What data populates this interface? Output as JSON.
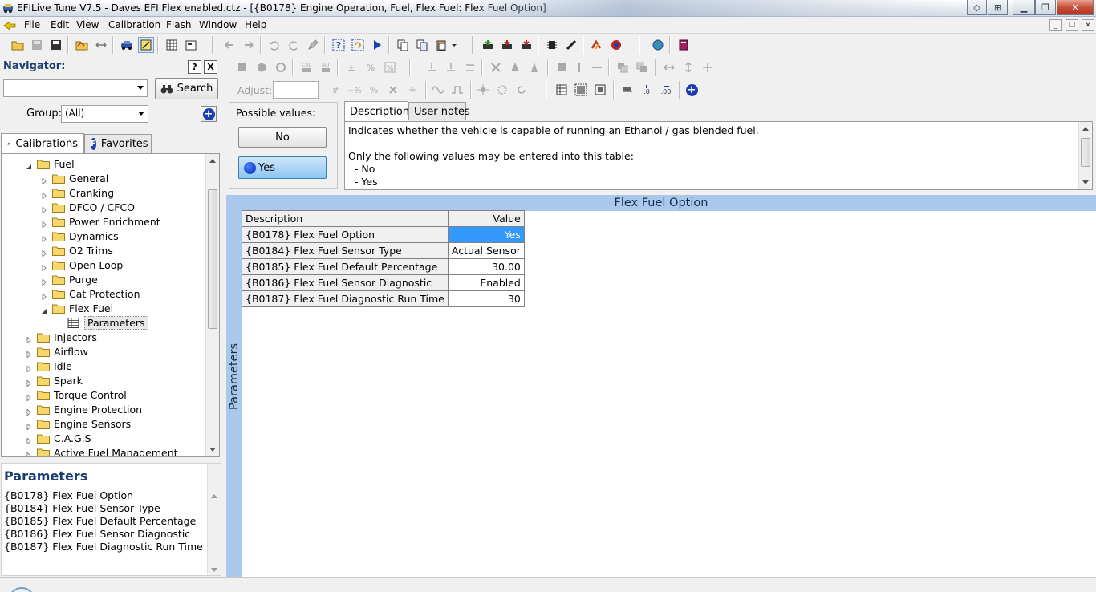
{
  "window": {
    "title": "EFILive Tune V7.5 - Daves EFI Flex enabled.ctz - [{B0178} Engine Operation, Fuel, Flex Fuel: Flex Fuel Option]"
  },
  "menu": {
    "file": "File",
    "edit": "Edit",
    "view": "View",
    "calibration": "Calibration",
    "flash": "Flash",
    "window": "Window",
    "help": "Help"
  },
  "toolbar": {
    "adjust_label": "Adjust:",
    "adjust_value": ""
  },
  "navigator": {
    "label": "Navigator:",
    "help_btn": "?",
    "close_btn": "X",
    "search_value": "",
    "search_button": "Search",
    "group_label": "Group:",
    "group_value": "(All)",
    "tabs": {
      "calibrations": "Calibrations",
      "favorites": "Favorites"
    },
    "tree": [
      {
        "label": "Fuel",
        "level": 1,
        "state": "expanded"
      },
      {
        "label": "General",
        "level": 2,
        "state": "collapsed"
      },
      {
        "label": "Cranking",
        "level": 2,
        "state": "collapsed"
      },
      {
        "label": "DFCO / CFCO",
        "level": 2,
        "state": "collapsed"
      },
      {
        "label": "Power Enrichment",
        "level": 2,
        "state": "collapsed"
      },
      {
        "label": "Dynamics",
        "level": 2,
        "state": "collapsed"
      },
      {
        "label": "O2 Trims",
        "level": 2,
        "state": "collapsed"
      },
      {
        "label": "Open Loop",
        "level": 2,
        "state": "collapsed"
      },
      {
        "label": "Purge",
        "level": 2,
        "state": "collapsed"
      },
      {
        "label": "Cat Protection",
        "level": 2,
        "state": "collapsed"
      },
      {
        "label": "Flex Fuel",
        "level": 2,
        "state": "expanded"
      },
      {
        "label": "Parameters",
        "level": 3,
        "state": "leaf"
      },
      {
        "label": "Injectors",
        "level": 1,
        "state": "collapsed"
      },
      {
        "label": "Airflow",
        "level": 1,
        "state": "collapsed"
      },
      {
        "label": "Idle",
        "level": 1,
        "state": "collapsed"
      },
      {
        "label": "Spark",
        "level": 1,
        "state": "collapsed"
      },
      {
        "label": "Torque Control",
        "level": 1,
        "state": "collapsed"
      },
      {
        "label": "Engine Protection",
        "level": 1,
        "state": "collapsed"
      },
      {
        "label": "Engine Sensors",
        "level": 1,
        "state": "collapsed"
      },
      {
        "label": "C.A.G.S",
        "level": 1,
        "state": "collapsed"
      },
      {
        "label": "Active Fuel Management",
        "level": 1,
        "state": "collapsed"
      }
    ]
  },
  "parameters_panel": {
    "heading": "Parameters",
    "items": [
      "{B0178} Flex Fuel Option",
      "{B0184} Flex Fuel Sensor Type",
      "{B0185} Flex Fuel Default Percentage",
      "{B0186} Flex Fuel Sensor Diagnostic",
      "{B0187} Flex Fuel Diagnostic Run Time"
    ]
  },
  "possible_values": {
    "label": "Possible values:",
    "no": "No",
    "yes": "Yes"
  },
  "description": {
    "tabs": {
      "description": "Description",
      "user_notes": "User notes"
    },
    "lines": [
      "Indicates whether the vehicle is capable of running an Ethanol / gas blended fuel.",
      "",
      "Only the following values may be entered into this table:",
      "  - No",
      "  - Yes"
    ]
  },
  "table": {
    "title": "Flex Fuel Option",
    "side_label": "Parameters",
    "header": {
      "description": "Description",
      "value": "Value"
    },
    "rows": [
      {
        "description": "{B0178} Flex Fuel Option",
        "value": "Yes"
      },
      {
        "description": "{B0184} Flex Fuel Sensor Type",
        "value": "Actual Sensor"
      },
      {
        "description": "{B0185} Flex Fuel Default Percentage",
        "value": "30.00"
      },
      {
        "description": "{B0186} Flex Fuel Sensor Diagnostic",
        "value": "Enabled"
      },
      {
        "description": "{B0187} Flex Fuel Diagnostic Run Time",
        "value": "30"
      }
    ]
  },
  "colors": {
    "accent_blue": "#a9c8ec",
    "selection": "#3399ff",
    "folder": "#f5d76e"
  }
}
